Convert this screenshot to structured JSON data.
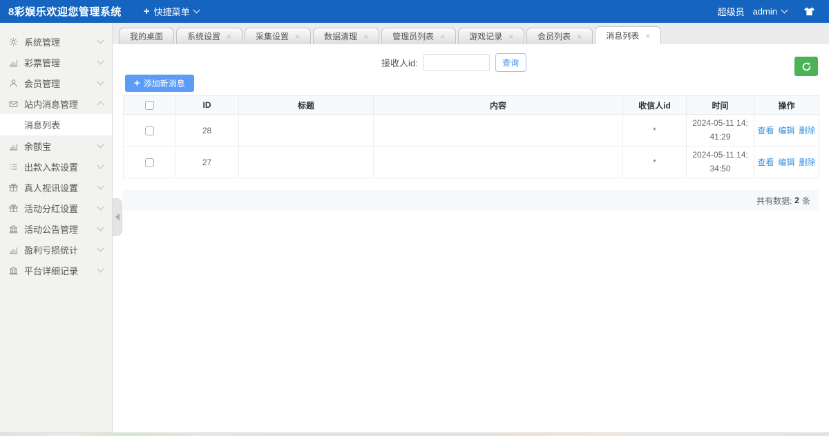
{
  "header": {
    "title": "8彩娱乐欢迎您管理系统",
    "quick_menu_label": "快捷菜单",
    "role": "超级员",
    "username": "admin"
  },
  "tabs": [
    {
      "label": "我的桌面",
      "closable": false,
      "active": false
    },
    {
      "label": "系统设置",
      "closable": true,
      "active": false
    },
    {
      "label": "采集设置",
      "closable": true,
      "active": false
    },
    {
      "label": "数据清理",
      "closable": true,
      "active": false
    },
    {
      "label": "管理员列表",
      "closable": true,
      "active": false
    },
    {
      "label": "游戏记录",
      "closable": true,
      "active": false
    },
    {
      "label": "会员列表",
      "closable": true,
      "active": false
    },
    {
      "label": "消息列表",
      "closable": true,
      "active": true
    }
  ],
  "sidebar": {
    "items": [
      {
        "label": "系统管理",
        "icon": "gear-icon",
        "state": "collapsed",
        "children": []
      },
      {
        "label": "彩票管理",
        "icon": "chart-icon",
        "state": "collapsed",
        "children": []
      },
      {
        "label": "会员管理",
        "icon": "user-icon",
        "state": "collapsed",
        "children": []
      },
      {
        "label": "站内消息管理",
        "icon": "mail-icon",
        "state": "expanded",
        "children": [
          {
            "label": "消息列表",
            "active": true
          }
        ]
      },
      {
        "label": "余额宝",
        "icon": "chart-icon",
        "state": "collapsed",
        "children": []
      },
      {
        "label": "出款入款设置",
        "icon": "list-icon",
        "state": "collapsed",
        "children": []
      },
      {
        "label": "真人视讯设置",
        "icon": "gift-icon",
        "state": "collapsed",
        "children": []
      },
      {
        "label": "活动分红设置",
        "icon": "gift-icon",
        "state": "collapsed",
        "children": []
      },
      {
        "label": "活动公告管理",
        "icon": "bank-icon",
        "state": "collapsed",
        "children": []
      },
      {
        "label": "盈利亏损统计",
        "icon": "chart-icon",
        "state": "collapsed",
        "children": []
      },
      {
        "label": "平台详细记录",
        "icon": "bank-icon",
        "state": "collapsed",
        "children": []
      }
    ]
  },
  "toolbar": {
    "search_label": "接收人id:",
    "search_value": "",
    "query_button": "查询",
    "add_button": "添加新消息"
  },
  "table": {
    "columns": [
      "",
      "ID",
      "标题",
      "内容",
      "收信人id",
      "时间",
      "操作"
    ],
    "rows": [
      {
        "id": "28",
        "title": "",
        "content": "",
        "receiver_id": "*",
        "time": "2024-05-11 14:41:29",
        "actions": [
          "查看",
          "编辑",
          "删除"
        ]
      },
      {
        "id": "27",
        "title": "",
        "content": "",
        "receiver_id": "*",
        "time": "2024-05-11 14:34:50",
        "actions": [
          "查看",
          "编辑",
          "删除"
        ]
      }
    ]
  },
  "footer": {
    "total_label": "共有数据:",
    "total_count": "2",
    "total_unit": "条"
  },
  "colors": {
    "topbar_blue": "#1565c0",
    "primary_button_blue": "#5b9cf8",
    "refresh_green": "#4cb256",
    "link_blue": "#3d91e0"
  },
  "icons": [
    "plus-icon",
    "chevron-down-icon",
    "chevron-up-icon",
    "tshirt-icon",
    "gear-icon",
    "chart-icon",
    "user-icon",
    "mail-icon",
    "list-icon",
    "gift-icon",
    "bank-icon",
    "refresh-icon",
    "close-icon",
    "collapse-arrow-icon"
  ]
}
